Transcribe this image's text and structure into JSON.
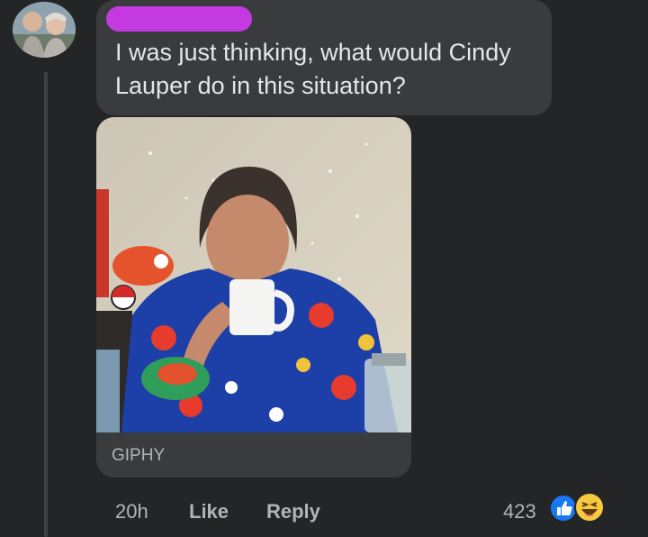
{
  "comment": {
    "text": "I was just thinking, what would Cindy Lauper do in this situation?"
  },
  "gif": {
    "source_label": "GIPHY"
  },
  "meta": {
    "time": "20h",
    "like_label": "Like",
    "reply_label": "Reply",
    "reaction_count": "423",
    "reactions": [
      "like-icon",
      "haha-icon"
    ]
  },
  "colors": {
    "background": "#242526",
    "bubble": "#3a3b3c",
    "text": "#e4e6eb",
    "muted": "#b0b3b8",
    "like_blue": "#1877f2",
    "haha_yellow": "#f7c940",
    "redaction": "#c33be0"
  }
}
